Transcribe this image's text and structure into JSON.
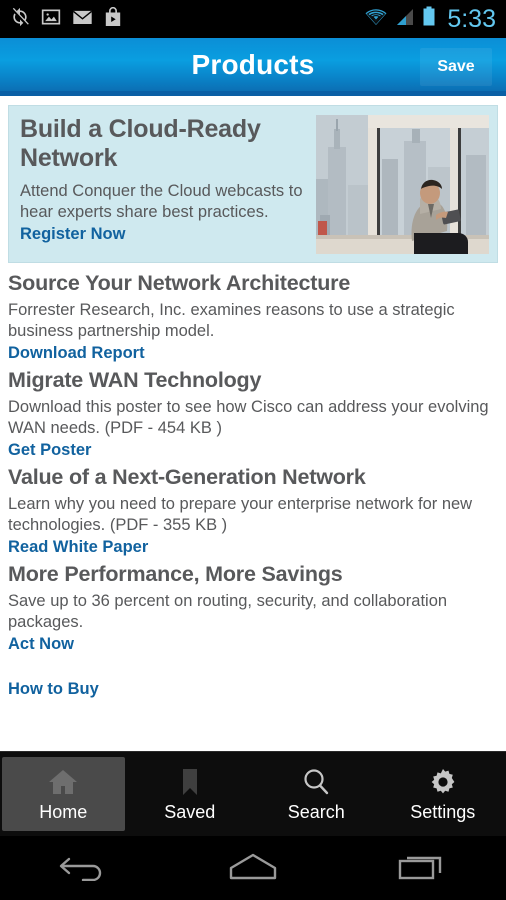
{
  "status_bar": {
    "time": "5:33",
    "left_icons": [
      "sync-icon",
      "image-icon",
      "email-icon",
      "play-store-icon"
    ],
    "right_icons": [
      "wifi-icon",
      "cellular-signal-icon",
      "battery-icon"
    ],
    "time_color": "#63c8f0",
    "background": "#000000"
  },
  "app_bar": {
    "title": "Products",
    "save_label": "Save",
    "accent": "#0a9ee0"
  },
  "promo": {
    "title": "Build a Cloud-Ready Network",
    "body": "Attend Conquer the Cloud webcasts to hear experts share best practices.",
    "link": "Register Now",
    "image_alt": "businessman-with-tablet-by-window-city-skyline",
    "background": "#cfe9ef",
    "link_color": "#11629f"
  },
  "articles": [
    {
      "title": "Source Your Network Architecture",
      "desc": "Forrester Research, Inc. examines reasons to use a strategic business partnership model.",
      "link": "Download Report"
    },
    {
      "title": "Migrate WAN Technology",
      "desc": "Download this poster to see how Cisco can address your evolving WAN needs. (PDF - 454 KB )",
      "link": "Get Poster"
    },
    {
      "title": "Value of a Next-Generation Network",
      "desc": "Learn why you need to prepare your enterprise network for new technologies. (PDF - 355 KB )",
      "link": "Read White Paper"
    },
    {
      "title": "More Performance, More Savings",
      "desc": "Save up to 36 percent on routing, security, and collaboration packages.",
      "link": "Act Now"
    }
  ],
  "how_to_buy": "How to Buy",
  "zoom_control": {
    "zoom_out_icon": "magnifier-minus-icon",
    "zoom_in_icon": "magnifier-plus-icon",
    "zoom_out_enabled": false,
    "zoom_in_enabled": true
  },
  "tabs": [
    {
      "label": "Home",
      "icon": "home-icon",
      "selected": true
    },
    {
      "label": "Saved",
      "icon": "bookmark-icon",
      "selected": false
    },
    {
      "label": "Search",
      "icon": "search-icon",
      "selected": false
    },
    {
      "label": "Settings",
      "icon": "gear-icon",
      "selected": false
    }
  ],
  "nav_bar": {
    "buttons": [
      "back-icon",
      "home-icon",
      "recents-icon"
    ]
  }
}
